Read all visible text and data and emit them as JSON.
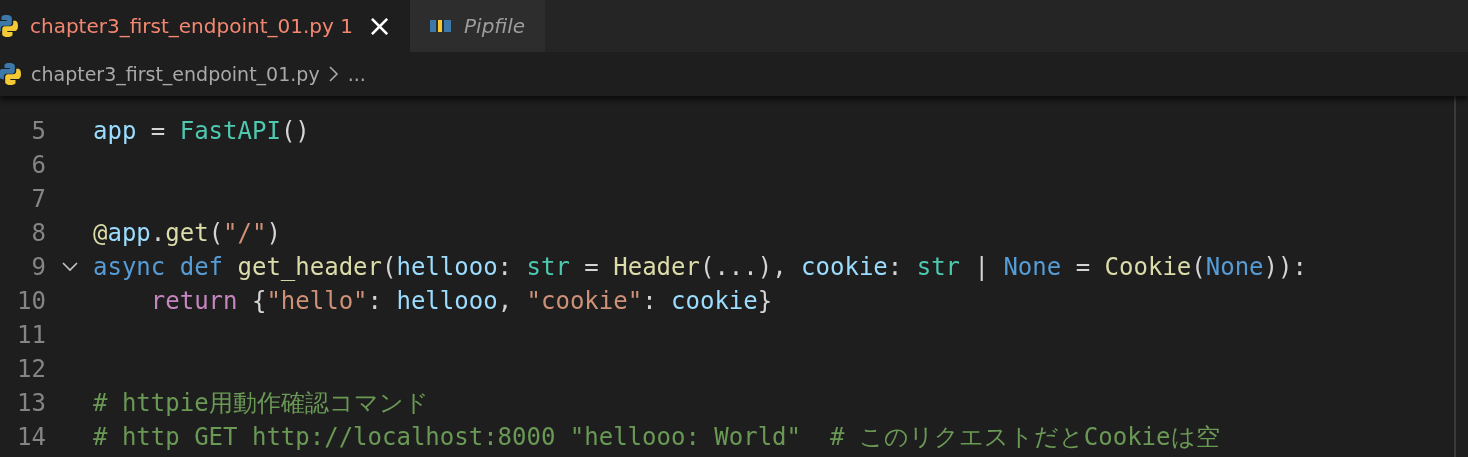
{
  "tabs": [
    {
      "label": "chapter3_first_endpoint_01.py",
      "problems": "1",
      "close": "×",
      "selected": true,
      "preview": false,
      "kind": "python"
    },
    {
      "label": "Pipfile",
      "selected": false,
      "preview": true,
      "kind": "pipfile"
    }
  ],
  "breadcrumb": [
    {
      "label": "chapter3_first_endpoint_01.py",
      "kind": "python"
    },
    {
      "label": "...",
      "kind": "more"
    }
  ],
  "lines": [
    {
      "number": "5",
      "tokens": [
        {
          "text": "app",
          "kind": "variable"
        },
        {
          "text": " = ",
          "kind": "plain"
        },
        {
          "text": "FastAPI",
          "kind": "class"
        },
        {
          "text": "()",
          "kind": "plain"
        }
      ]
    },
    {
      "number": "6"
    },
    {
      "number": "7"
    },
    {
      "number": "8",
      "tokens": [
        {
          "text": "@",
          "kind": "function"
        },
        {
          "text": "app",
          "kind": "variable"
        },
        {
          "text": ".",
          "kind": "plain"
        },
        {
          "text": "get",
          "kind": "function"
        },
        {
          "text": "(",
          "kind": "plain"
        },
        {
          "text": "\"/\"",
          "kind": "string"
        },
        {
          "text": ")",
          "kind": "plain"
        }
      ]
    },
    {
      "number": "9",
      "expanded": true,
      "tokens": [
        {
          "text": "async def ",
          "kind": "keyword"
        },
        {
          "text": "get_header",
          "kind": "function"
        },
        {
          "text": "(",
          "kind": "plain"
        },
        {
          "text": "hellooo",
          "kind": "variable"
        },
        {
          "text": ": ",
          "kind": "plain"
        },
        {
          "text": "str",
          "kind": "class"
        },
        {
          "text": " = ",
          "kind": "plain"
        },
        {
          "text": "Header",
          "kind": "function"
        },
        {
          "text": "(...), ",
          "kind": "plain"
        },
        {
          "text": "cookie",
          "kind": "variable"
        },
        {
          "text": ": ",
          "kind": "plain"
        },
        {
          "text": "str",
          "kind": "class"
        },
        {
          "text": " | ",
          "kind": "plain"
        },
        {
          "text": "None",
          "kind": "keyword"
        },
        {
          "text": " = ",
          "kind": "plain"
        },
        {
          "text": "Cookie",
          "kind": "function"
        },
        {
          "text": "(",
          "kind": "plain"
        },
        {
          "text": "None",
          "kind": "keyword"
        },
        {
          "text": ")):",
          "kind": "plain"
        }
      ]
    },
    {
      "number": "10",
      "indented": true,
      "tokens": [
        {
          "text": "return",
          "kind": "control"
        },
        {
          "text": " {",
          "kind": "plain"
        },
        {
          "text": "\"hello\"",
          "kind": "string"
        },
        {
          "text": ": ",
          "kind": "plain"
        },
        {
          "text": "hellooo",
          "kind": "variable"
        },
        {
          "text": ", ",
          "kind": "plain"
        },
        {
          "text": "\"cookie\"",
          "kind": "string"
        },
        {
          "text": ": ",
          "kind": "plain"
        },
        {
          "text": "cookie",
          "kind": "variable"
        },
        {
          "text": "}",
          "kind": "plain"
        }
      ]
    },
    {
      "number": "11"
    },
    {
      "number": "12"
    },
    {
      "number": "13",
      "tokens": [
        {
          "text": "# httpie用動作確認コマンド",
          "kind": "comment"
        }
      ]
    },
    {
      "number": "14",
      "tokens": [
        {
          "text": "# http GET http://localhost:8000 \"hellooo: World\"  # このリクエストだとCookieは空",
          "kind": "comment"
        }
      ]
    }
  ]
}
